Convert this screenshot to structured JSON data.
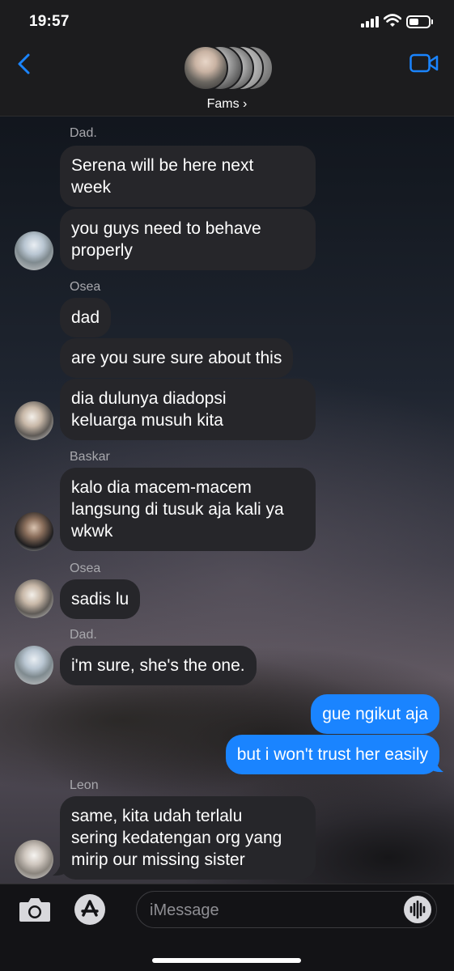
{
  "status_bar": {
    "time": "19:57"
  },
  "header": {
    "group_name": "Fams ›"
  },
  "messages": [
    {
      "sender": "Dad.",
      "text_lines": [
        "Serena will be here next",
        "week"
      ]
    },
    {
      "text_lines": [
        "you guys need to behave",
        "properly"
      ]
    },
    {
      "sender": "Osea",
      "text_lines": [
        "dad"
      ]
    },
    {
      "text_lines": [
        "are you sure sure about this"
      ]
    },
    {
      "text_lines": [
        "dia dulunya diadopsi",
        "keluarga musuh kita"
      ]
    },
    {
      "sender": "Baskar",
      "text_lines": [
        "kalo dia macem-macem",
        "langsung di tusuk aja kali ya",
        "wkwk"
      ]
    },
    {
      "sender": "Osea",
      "text_lines": [
        "sadis lu"
      ]
    },
    {
      "sender": "Dad.",
      "text_lines": [
        "i'm sure, she's the one."
      ]
    },
    {
      "text_lines": [
        "gue ngikut aja"
      ]
    },
    {
      "text_lines": [
        "but i won't trust her easily"
      ]
    },
    {
      "sender": "Leon",
      "text_lines": [
        "same, kita udah terlalu",
        "sering kedatengan org yang",
        "mirip our missing sister"
      ]
    }
  ],
  "input": {
    "placeholder": "iMessage"
  },
  "colors": {
    "accent": "#1a84ff",
    "incoming_bubble": "#26262a",
    "header_bg": "#1c1c1e"
  }
}
